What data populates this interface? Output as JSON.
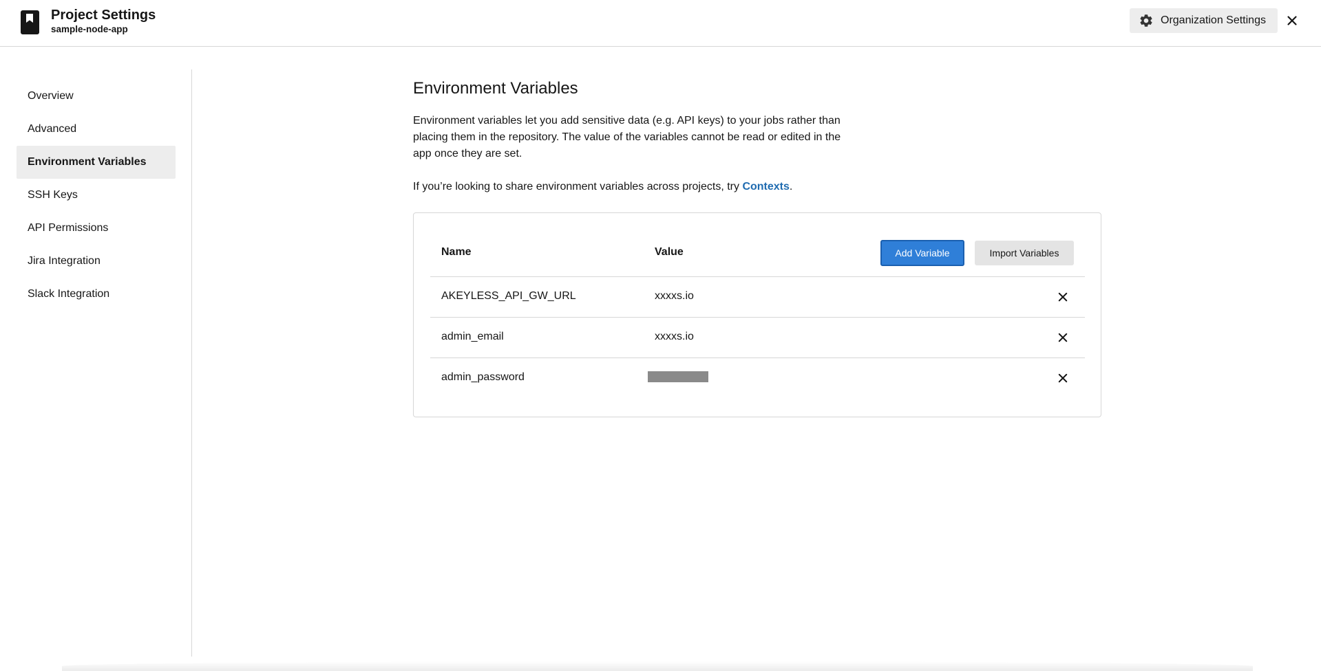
{
  "header": {
    "title": "Project Settings",
    "subtitle": "sample-node-app",
    "org_settings_label": "Organization Settings",
    "icons": {
      "project": "bookmark-icon",
      "org": "gear-icon",
      "close": "close-icon"
    }
  },
  "sidebar": {
    "items": [
      {
        "label": "Overview",
        "active": false
      },
      {
        "label": "Advanced",
        "active": false
      },
      {
        "label": "Environment Variables",
        "active": true
      },
      {
        "label": "SSH Keys",
        "active": false
      },
      {
        "label": "API Permissions",
        "active": false
      },
      {
        "label": "Jira Integration",
        "active": false
      },
      {
        "label": "Slack Integration",
        "active": false
      }
    ]
  },
  "main": {
    "title": "Environment Variables",
    "description": "Environment variables let you add sensitive data (e.g. API keys) to your jobs rather than placing them in the repository. The value of the variables cannot be read or edited in the app once they are set.",
    "contexts_prefix": "If you’re looking to share environment variables across projects, try ",
    "contexts_link": "Contexts",
    "contexts_suffix": "."
  },
  "table": {
    "col_name": "Name",
    "col_value": "Value",
    "add_button": "Add Variable",
    "import_button": "Import Variables",
    "rows": [
      {
        "name": "AKEYLESS_API_GW_URL",
        "value": "xxxxs.io",
        "masked": false
      },
      {
        "name": "admin_email",
        "value": "xxxxs.io",
        "masked": false
      },
      {
        "name": "admin_password",
        "value": "",
        "masked": true
      }
    ]
  },
  "colors": {
    "accent": "#2f7fd8",
    "link": "#1f6bb0",
    "active_bg": "#ededed"
  }
}
